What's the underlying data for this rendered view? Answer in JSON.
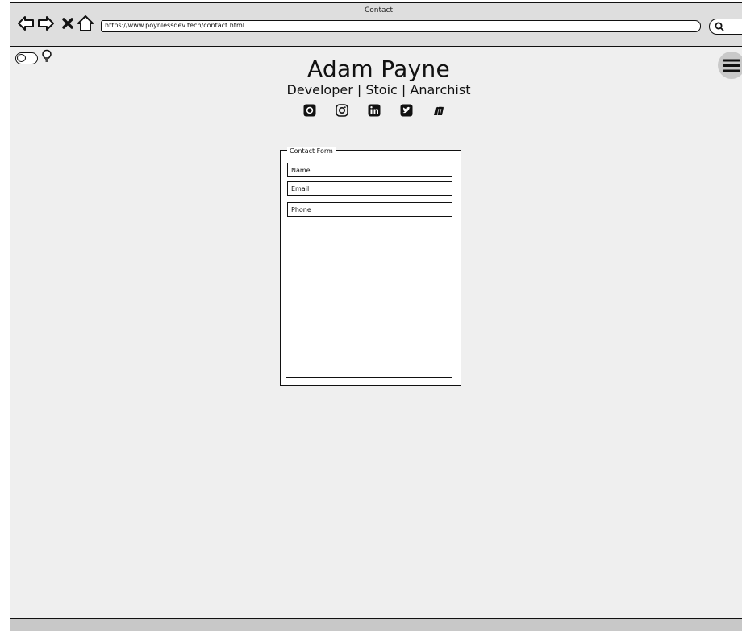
{
  "window": {
    "title": "Contact",
    "url": "https://www.poynlessdev.tech/contact.html"
  },
  "icons": {
    "back": "arrow-left-icon",
    "forward": "arrow-right-icon",
    "close": "close-icon",
    "home": "home-icon",
    "search": "search-icon",
    "theme_toggle": "toggle-icon",
    "lightbulb": "lightbulb-icon",
    "menu": "hamburger-menu-icon"
  },
  "header": {
    "name": "Adam Payne",
    "tagline": "Developer | Stoic | Anarchist"
  },
  "socials": [
    {
      "icon": "github-icon"
    },
    {
      "icon": "instagram-icon"
    },
    {
      "icon": "linkedin-icon"
    },
    {
      "icon": "twitter-icon"
    },
    {
      "icon": "medium-icon"
    }
  ],
  "form": {
    "legend": "Contact Form",
    "name_placeholder": "Name",
    "email_placeholder": "Email",
    "phone_placeholder": "Phone",
    "message_value": ""
  }
}
